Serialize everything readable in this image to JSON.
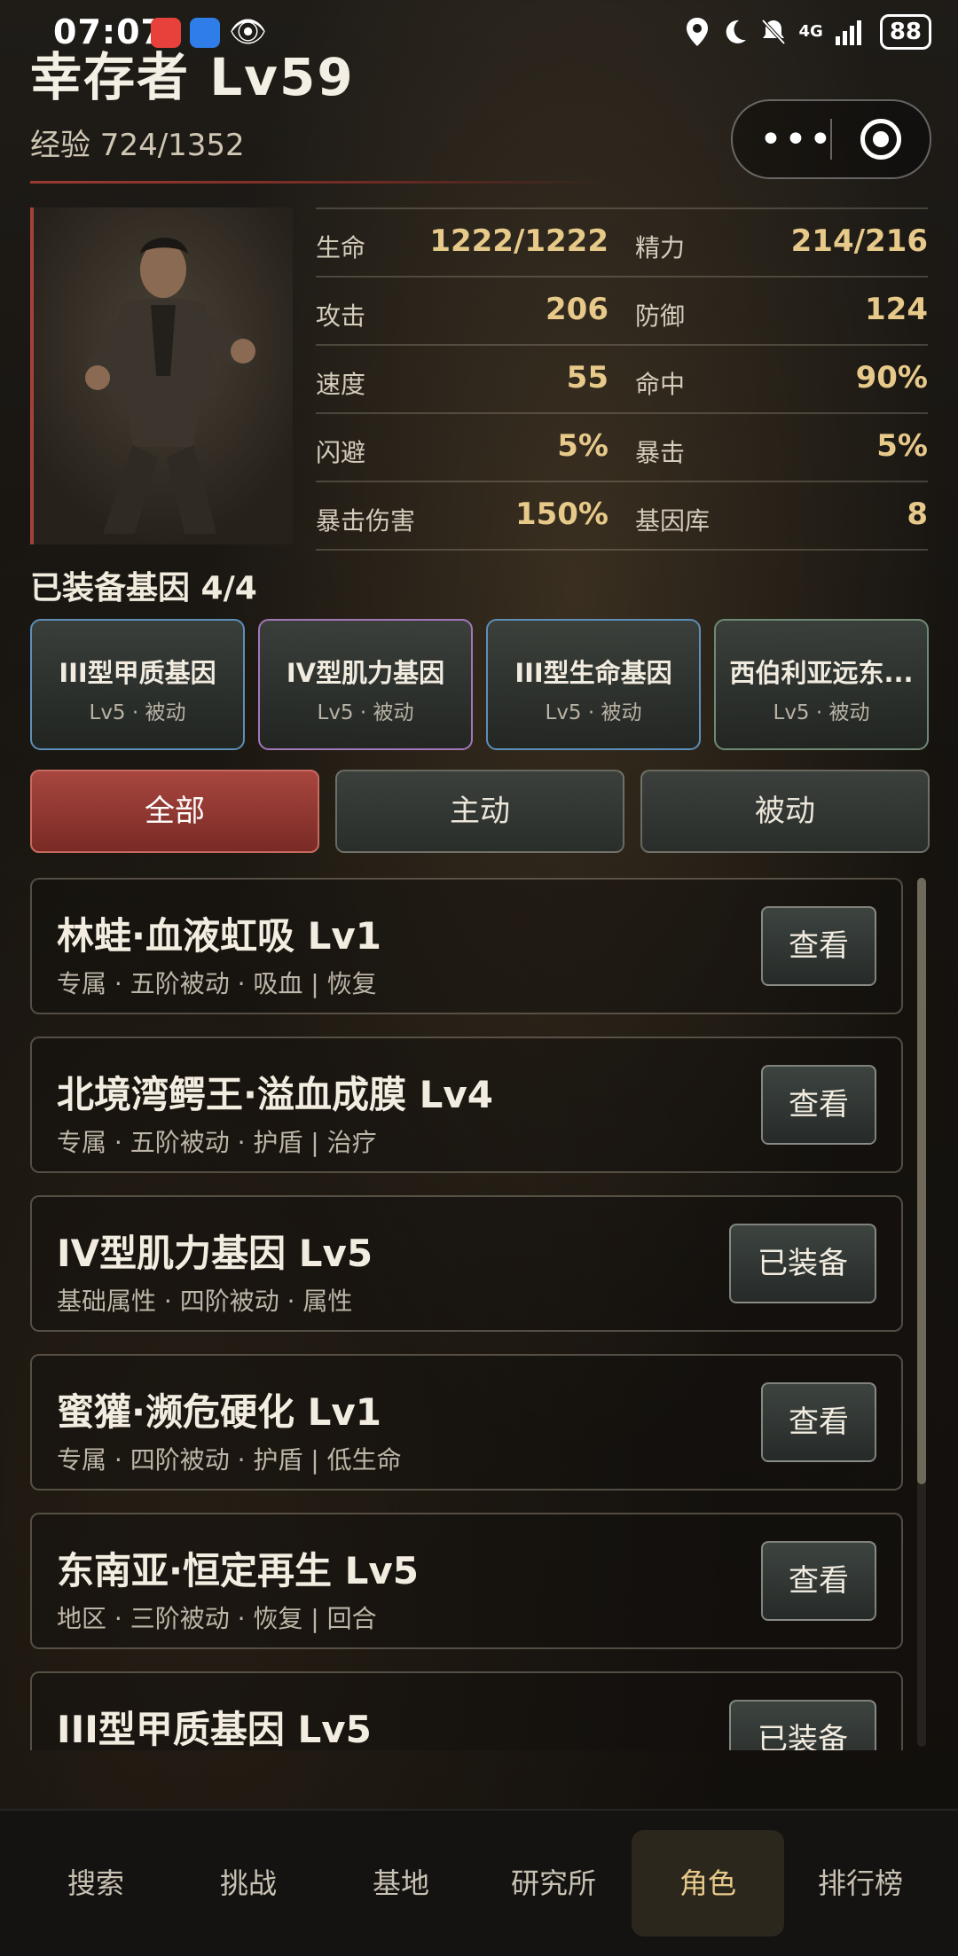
{
  "status_bar": {
    "time": "07:07",
    "battery": "88",
    "network": "4G",
    "icons": [
      "location-icon",
      "moon-icon",
      "bell-off-icon",
      "signal-icon",
      "battery-icon"
    ]
  },
  "header": {
    "title": "幸存者 Lv59",
    "exp": "经验 724/1352"
  },
  "stats": [
    {
      "label": "生命",
      "value": "1222/1222",
      "label2": "精力",
      "value2": "214/216"
    },
    {
      "label": "攻击",
      "value": "206",
      "label2": "防御",
      "value2": "124"
    },
    {
      "label": "速度",
      "value": "55",
      "label2": "命中",
      "value2": "90%"
    },
    {
      "label": "闪避",
      "value": "5%",
      "label2": "暴击",
      "value2": "5%"
    },
    {
      "label": "暴击伤害",
      "value": "150%",
      "label2": "基因库",
      "value2": "8"
    }
  ],
  "equipped": {
    "title": "已装备基因 4/4",
    "genes": [
      {
        "name": "III型甲质基因",
        "sub": "Lv5 · 被动",
        "border": "#5d8fb8"
      },
      {
        "name": "IV型肌力基因",
        "sub": "Lv5 · 被动",
        "border": "#a277b8"
      },
      {
        "name": "III型生命基因",
        "sub": "Lv5 · 被动",
        "border": "#5d8fb8"
      },
      {
        "name": "西伯利亚远东...",
        "sub": "Lv5 · 被动",
        "border": "#6f8a74"
      }
    ]
  },
  "tabs": [
    {
      "label": "全部",
      "active": true
    },
    {
      "label": "主动",
      "active": false
    },
    {
      "label": "被动",
      "active": false
    }
  ],
  "items": [
    {
      "name": "林蛙·血液虹吸 Lv1",
      "desc": "专属 · 五阶被动 · 吸血 | 恢复",
      "button": "查看"
    },
    {
      "name": "北境湾鳄王·溢血成膜 Lv4",
      "desc": "专属 · 五阶被动 · 护盾 | 治疗",
      "button": "查看"
    },
    {
      "name": "IV型肌力基因 Lv5",
      "desc": "基础属性 · 四阶被动 · 属性",
      "button": "已装备"
    },
    {
      "name": "蜜獾·濒危硬化 Lv1",
      "desc": "专属 · 四阶被动 · 护盾 | 低生命",
      "button": "查看"
    },
    {
      "name": "东南亚·恒定再生 Lv5",
      "desc": "地区 · 三阶被动 · 恢复 | 回合",
      "button": "查看"
    },
    {
      "name": "III型甲质基因 Lv5",
      "desc": "",
      "button": "已装备"
    }
  ],
  "nav": [
    {
      "label": "搜索",
      "active": false
    },
    {
      "label": "挑战",
      "active": false
    },
    {
      "label": "基地",
      "active": false
    },
    {
      "label": "研究所",
      "active": false
    },
    {
      "label": "角色",
      "active": true
    },
    {
      "label": "排行榜",
      "active": false
    }
  ]
}
